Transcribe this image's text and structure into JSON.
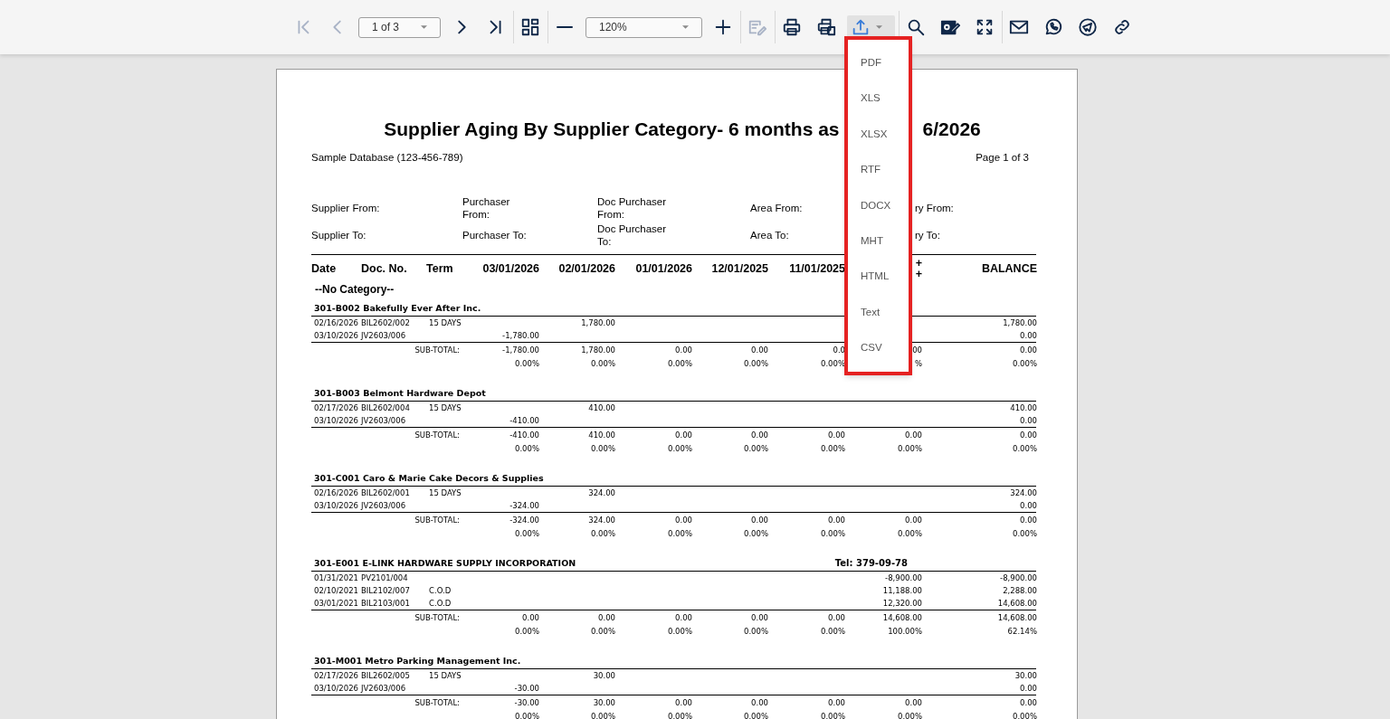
{
  "toolbar": {
    "groups": [
      [
        {
          "kind": "button",
          "disabled": true
        },
        {
          "kind": "button",
          "disabled": true
        },
        {
          "kind": "select",
          "value": "1 of 3"
        },
        {
          "kind": "button",
          "disabled": false
        },
        {
          "kind": "button",
          "disabled": false
        }
      ],
      [
        {
          "kind": "button",
          "disabled": false
        }
      ],
      [
        {
          "kind": "button",
          "disabled": false
        },
        {
          "kind": "select",
          "value": "120%"
        },
        {
          "kind": "button",
          "disabled": false
        }
      ],
      [
        {
          "kind": "button",
          "disabled": true
        }
      ],
      [
        {
          "kind": "button",
          "disabled": false
        },
        {
          "kind": "button",
          "disabled": false
        },
        {
          "kind": "dropdown",
          "disabled": false,
          "expanded": true
        }
      ],
      [
        {
          "kind": "button",
          "disabled": false
        },
        {
          "kind": "button",
          "disabled": false
        },
        {
          "kind": "button",
          "disabled": false
        }
      ],
      [
        {
          "kind": "button",
          "disabled": false
        },
        {
          "kind": "button",
          "disabled": false
        },
        {
          "kind": "button",
          "disabled": false
        },
        {
          "kind": "button",
          "disabled": false
        }
      ]
    ]
  },
  "export_menu": {
    "items": [
      "PDF",
      "XLS",
      "XLSX",
      "RTF",
      "DOCX",
      "MHT",
      "HTML",
      "Text",
      "CSV"
    ]
  },
  "report": {
    "title_parts": [
      "Supplier Aging By Supplier Category- 6 months as",
      "6/2026"
    ],
    "database": "Sample Database (123-456-789)",
    "page": "Page 1 of 3",
    "filters": [
      [
        "Supplier From:",
        "Purchaser From:",
        "Doc Purchaser From:",
        "Area From:",
        "ry From:"
      ],
      [
        "Supplier To:",
        "Purchaser To:",
        "Doc Purchaser To:",
        "Area To:",
        "ry To:"
      ]
    ],
    "columns": [
      "Date",
      "Doc. No.",
      "Term",
      "03/01/2026",
      "02/01/2026",
      "01/01/2026",
      "12/01/2025",
      "11/01/2025",
      "+\n+",
      "BALANCE"
    ],
    "category": "--No Category--",
    "suppliers": [
      {
        "name": "301-B002 Bakefully Ever After Inc.",
        "rows": [
          {
            "date": "02/16/2026",
            "doc": "BIL2602/002",
            "term": "15 DAYS",
            "aging_2": "1,780.00",
            "balance": "1,780.00"
          },
          {
            "date": "03/10/2026",
            "doc": "JV2603/006",
            "aging_1": "-1,780.00",
            "balance": "0.00"
          }
        ],
        "subtotal": {
          "label": "SUB-TOTAL:",
          "amounts": [
            "-1,780.00",
            "1,780.00",
            "0.00",
            "0.00",
            "0.0",
            "00",
            "0.00"
          ]
        },
        "percents": [
          "0.00%",
          "0.00%",
          "0.00%",
          "0.00%",
          "0.00%",
          "%",
          "0.00%"
        ]
      },
      {
        "name": "301-B003 Belmont Hardware Depot",
        "rows": [
          {
            "date": "02/17/2026",
            "doc": "BIL2602/004",
            "term": "15 DAYS",
            "aging_2": "410.00",
            "balance": "410.00"
          },
          {
            "date": "03/10/2026",
            "doc": "JV2603/006",
            "aging_1": "-410.00",
            "balance": "0.00"
          }
        ],
        "subtotal": {
          "label": "SUB-TOTAL:",
          "amounts": [
            "-410.00",
            "410.00",
            "0.00",
            "0.00",
            "0.00",
            "0.00",
            "0.00"
          ]
        },
        "percents": [
          "0.00%",
          "0.00%",
          "0.00%",
          "0.00%",
          "0.00%",
          "0.00%",
          "0.00%"
        ]
      },
      {
        "name": "301-C001 Caro & Marie Cake Decors & Supplies",
        "rows": [
          {
            "date": "02/16/2026",
            "doc": "BIL2602/001",
            "term": "15 DAYS",
            "aging_2": "324.00",
            "balance": "324.00"
          },
          {
            "date": "03/10/2026",
            "doc": "JV2603/006",
            "aging_1": "-324.00",
            "balance": "0.00"
          }
        ],
        "subtotal": {
          "label": "SUB-TOTAL:",
          "amounts": [
            "-324.00",
            "324.00",
            "0.00",
            "0.00",
            "0.00",
            "0.00",
            "0.00"
          ]
        },
        "percents": [
          "0.00%",
          "0.00%",
          "0.00%",
          "0.00%",
          "0.00%",
          "0.00%",
          "0.00%"
        ]
      },
      {
        "name": "301-E001 E-LINK HARDWARE SUPPLY INCORPORATION",
        "tel": "Tel: 379-09-78",
        "rows": [
          {
            "date": "01/31/2021",
            "doc": "PV2101/004",
            "aging_6": "-8,900.00",
            "balance": "-8,900.00"
          },
          {
            "date": "02/10/2021",
            "doc": "BIL2102/007",
            "term": "C.O.D",
            "aging_6": "11,188.00",
            "balance": "2,288.00"
          },
          {
            "date": "03/01/2021",
            "doc": "BIL2103/001",
            "term": "C.O.D",
            "aging_6": "12,320.00",
            "balance": "14,608.00"
          }
        ],
        "subtotal": {
          "label": "SUB-TOTAL:",
          "amounts": [
            "0.00",
            "0.00",
            "0.00",
            "0.00",
            "0.00",
            "14,608.00",
            "14,608.00"
          ]
        },
        "percents": [
          "0.00%",
          "0.00%",
          "0.00%",
          "0.00%",
          "0.00%",
          "100.00%",
          "62.14%"
        ]
      },
      {
        "name": "301-M001 Metro Parking Management Inc.",
        "rows": [
          {
            "date": "02/17/2026",
            "doc": "BIL2602/005",
            "term": "15 DAYS",
            "aging_2": "30.00",
            "balance": "30.00"
          },
          {
            "date": "03/10/2026",
            "doc": "JV2603/006",
            "aging_1": "-30.00",
            "balance": "0.00"
          }
        ],
        "subtotal": {
          "label": "SUB-TOTAL:",
          "amounts": [
            "-30.00",
            "30.00",
            "0.00",
            "0.00",
            "0.00",
            "0.00",
            "0.00"
          ]
        },
        "percents": [
          "0.00%",
          "0.00%",
          "0.00%",
          "0.00%",
          "0.00%",
          "0.00%",
          "0.00%"
        ]
      }
    ]
  }
}
